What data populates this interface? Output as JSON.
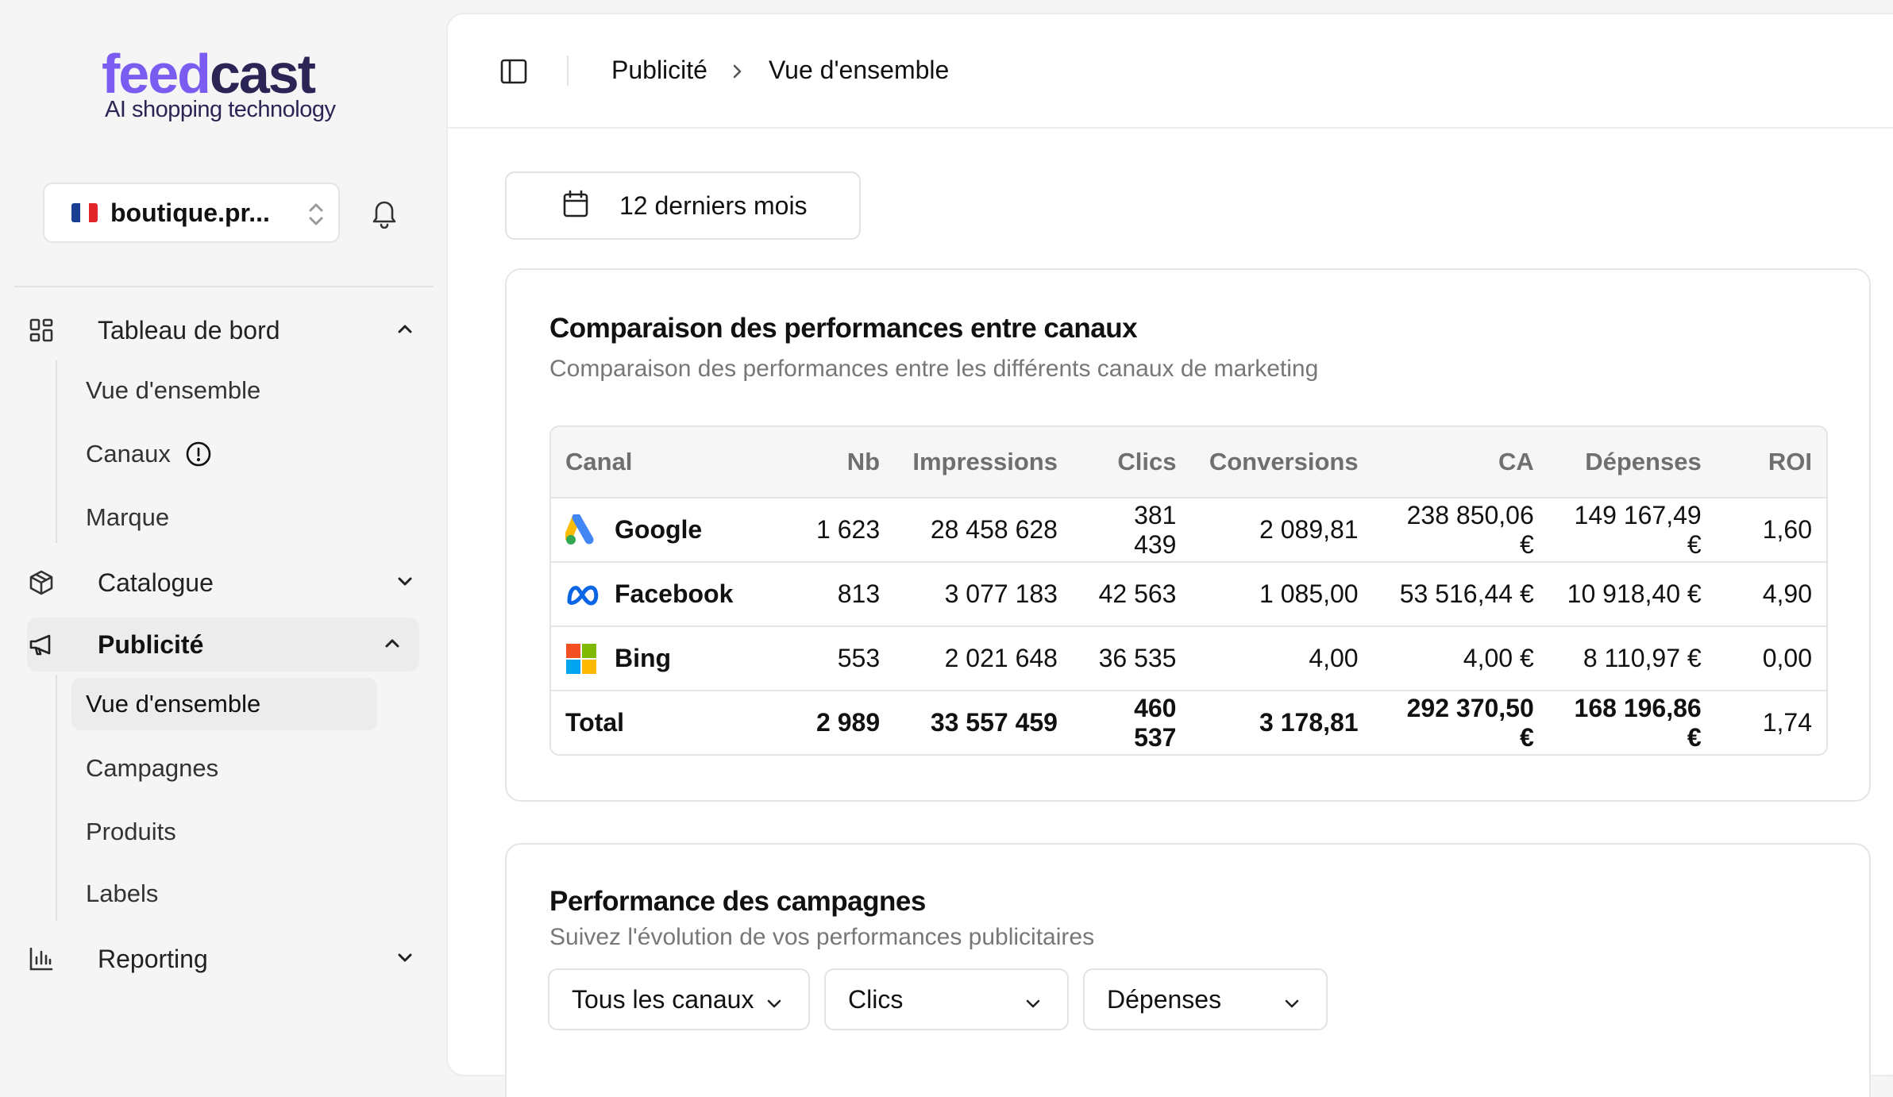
{
  "brand": {
    "name_part1": "feed",
    "name_part2": "cast",
    "tagline": "AI shopping technology"
  },
  "store": {
    "name": "boutique.pr...",
    "flag": "france-flag"
  },
  "sidebar": {
    "groups": [
      {
        "label": "Tableau de bord",
        "icon": "dashboard-icon",
        "expanded": true,
        "items": [
          "Vue d'ensemble",
          "Canaux",
          "Marque"
        ]
      },
      {
        "label": "Catalogue",
        "icon": "box-icon",
        "expanded": false
      },
      {
        "label": "Publicité",
        "icon": "megaphone-icon",
        "expanded": true,
        "active": true,
        "items": [
          "Vue d'ensemble",
          "Campagnes",
          "Produits",
          "Labels"
        ]
      },
      {
        "label": "Reporting",
        "icon": "bar-chart-icon",
        "expanded": false
      }
    ]
  },
  "breadcrumb": {
    "parent": "Publicité",
    "current": "Vue d'ensemble"
  },
  "date_filter": {
    "label": "12 derniers mois"
  },
  "comparison": {
    "title": "Comparaison des performances entre canaux",
    "subtitle": "Comparaison des performances entre les différents canaux de marketing",
    "columns": [
      "Canal",
      "Nb",
      "Impressions",
      "Clics",
      "Conversions",
      "CA",
      "Dépenses",
      "ROI"
    ],
    "rows": [
      {
        "canal": "Google",
        "nb": "1 623",
        "impressions": "28 458 628",
        "clics": "381 439",
        "conversions": "2 089,81",
        "ca": "238 850,06 €",
        "depenses": "149 167,49 €",
        "roi": "1,60"
      },
      {
        "canal": "Facebook",
        "nb": "813",
        "impressions": "3 077 183",
        "clics": "42 563",
        "conversions": "1 085,00",
        "ca": "53 516,44 €",
        "depenses": "10 918,40 €",
        "roi": "4,90"
      },
      {
        "canal": "Bing",
        "nb": "553",
        "impressions": "2 021 648",
        "clics": "36 535",
        "conversions": "4,00",
        "ca": "4,00 €",
        "depenses": "8 110,97 €",
        "roi": "0,00"
      },
      {
        "canal": "Total",
        "nb": "2 989",
        "impressions": "33 557 459",
        "clics": "460 537",
        "conversions": "3 178,81",
        "ca": "292 370,50 €",
        "depenses": "168 196,86 €",
        "roi": "1,74"
      }
    ],
    "colors": {
      "roi_positive": "#2e9e3e",
      "roi_negative": "#e0302b"
    }
  },
  "campaigns": {
    "title": "Performance des campagnes",
    "subtitle": "Suivez l'évolution de vos performances publicitaires",
    "filters": [
      "Tous les canaux",
      "Clics",
      "Dépenses"
    ]
  }
}
